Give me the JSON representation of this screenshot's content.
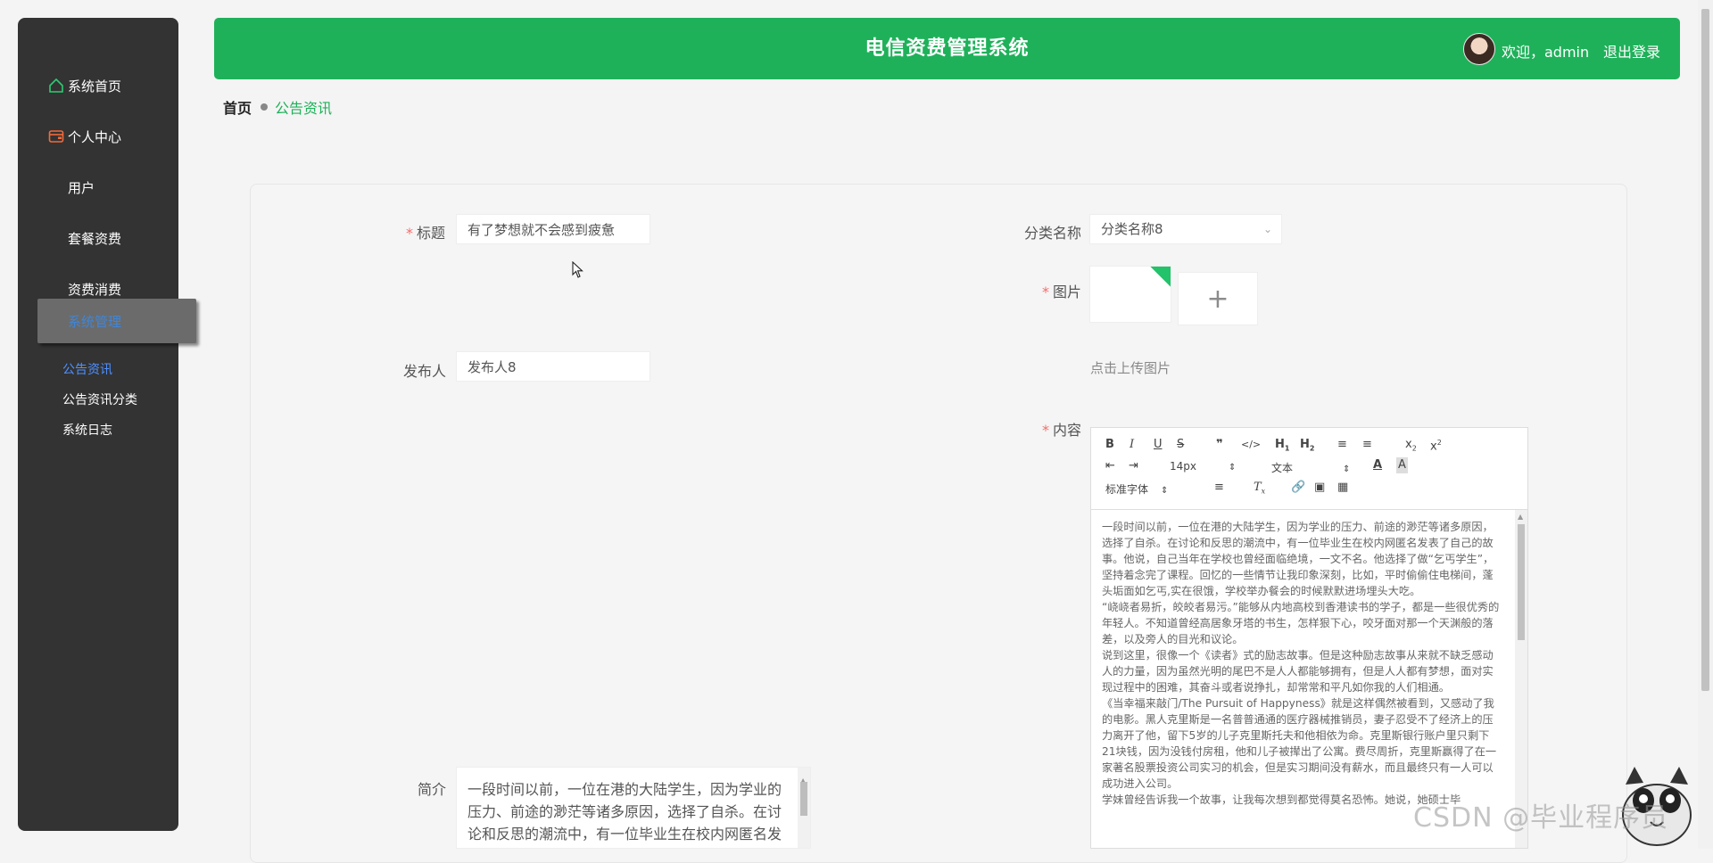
{
  "sidebar": {
    "items": [
      {
        "label": "系统首页",
        "icon": "home-icon"
      },
      {
        "label": "个人中心",
        "icon": "wallet-icon"
      },
      {
        "label": "用户",
        "icon": "grid-icon"
      },
      {
        "label": "套餐资费",
        "icon": "grid-icon"
      },
      {
        "label": "资费消费",
        "icon": "grid-icon"
      },
      {
        "label": "系统管理",
        "icon": "grid-icon"
      }
    ],
    "subitems": [
      {
        "label": "公告资讯"
      },
      {
        "label": "公告资讯分类"
      },
      {
        "label": "系统日志"
      }
    ]
  },
  "header": {
    "title": "电信资费管理系统",
    "welcome": "欢迎，admin",
    "logout": "退出登录",
    "accent": "#1fb15a"
  },
  "breadcrumb": {
    "home": "首页",
    "current": "公告资讯"
  },
  "form": {
    "title_label": "标题",
    "title_value": "有了梦想就不会感到疲惫",
    "category_label": "分类名称",
    "category_value": "分类名称8",
    "image_label": "图片",
    "upload_hint": "点击上传图片",
    "publisher_label": "发布人",
    "publisher_value": "发布人8",
    "content_label": "内容",
    "intro_label": "简介",
    "intro_value": "一段时间以前，一位在港的大陆学生，因为学业的压力、前途的渺茫等诸多原因，选择了自杀。在讨论和反思的潮流中，有一位毕业生在校内网匿名发表了自己的故事。他说，自己当年在学校也曾经面临绝境，一文不名。"
  },
  "editor": {
    "font_size": "14px",
    "header_type": "文本",
    "font_family": "标准字体",
    "paragraphs": [
      "一段时间以前，一位在港的大陆学生，因为学业的压力、前途的渺茫等诸多原因，选择了自杀。在讨论和反思的潮流中，有一位毕业生在校内网匿名发表了自己的故事。他说，自己当年在学校也曾经面临绝境，一文不名。他选择了做“乞丐学生”，坚持着念完了课程。回忆的一些情节让我印象深刻，比如，平时偷偷住电梯间，蓬头垢面如乞丐,实在很饿，学校举办餐会的时候默默进场埋头大吃。",
      "“峣峣者易折，皎皎者易污。”能够从内地高校到香港读书的学子，都是一些很优秀的年轻人。不知道曾经高居象牙塔的书生，怎样狠下心，咬牙面对那一个天渊般的落差，以及旁人的目光和议论。",
      "说到这里，很像一个《读者》式的励志故事。但是这种励志故事从来就不缺乏感动人的力量，因为虽然光明的尾巴不是人人都能够拥有，但是人人都有梦想，面对实现过程中的困难，其奋斗或者说挣扎，却常常和平凡如你我的人们相通。",
      "《当幸福来敲门/The Pursuit of Happyness》就是这样偶然被看到，又感动了我的电影。黑人克里斯是一名普普通通的医疗器械推销员，妻子忍受不了经济上的压力离开了他，留下5岁的儿子克里斯托夫和他相依为命。克里斯银行账户里只剩下21块钱，因为没钱付房租，他和儿子被撵出了公寓。费尽周折，克里斯赢得了在一家著名股票投资公司实习的机会，但是实习期间没有薪水，而且最终只有一人可以成功进入公司。",
      "学妹曾经告诉我一个故事，让我每次想到都觉得莫名恐怖。她说，她硕士毕"
    ]
  },
  "watermark": "CSDN @毕业程序员"
}
